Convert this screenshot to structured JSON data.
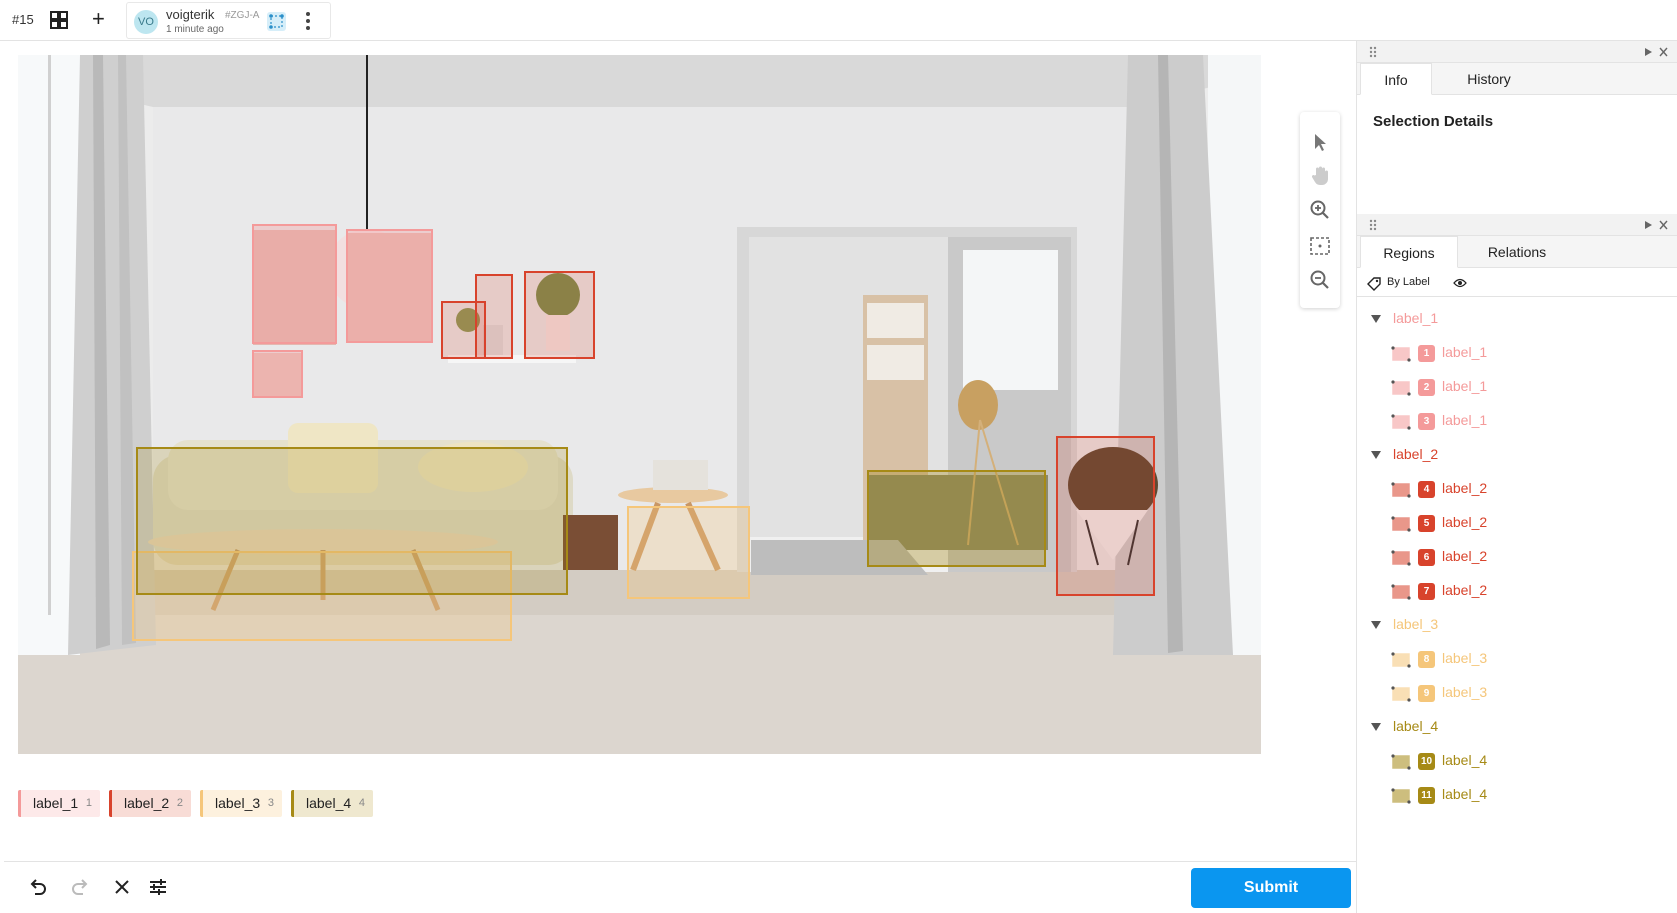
{
  "topbar": {
    "task_id": "#15",
    "grid_icon": "grid-icon",
    "add_icon": "plus-icon",
    "add_glyph": "+",
    "user": {
      "initials": "VO",
      "name": "voigterik",
      "hash": "#ZGJ-A",
      "time": "1 minute ago"
    },
    "more_icon": "kebab-menu-icon"
  },
  "image": {
    "description_icon": "interior-photo"
  },
  "tools": [
    "pointer-icon",
    "hand-pan-icon",
    "zoom-in-icon",
    "fit-to-screen-icon",
    "zoom-out-icon"
  ],
  "labels": [
    {
      "name": "label_1",
      "hotkey": "1",
      "color": "#f49a9a"
    },
    {
      "name": "label_2",
      "hotkey": "2",
      "color": "#d8432c"
    },
    {
      "name": "label_3",
      "hotkey": "3",
      "color": "#f5c67a"
    },
    {
      "name": "label_4",
      "hotkey": "4",
      "color": "#a68a16"
    }
  ],
  "bottombar": {
    "icons": [
      "undo-icon",
      "redo-icon",
      "reset-icon",
      "settings-icon"
    ],
    "submit_label": "Submit"
  },
  "sidebar": {
    "top_tabs": [
      "Info",
      "History"
    ],
    "selection_title": "Selection Details",
    "bottom_tabs": [
      "Regions",
      "Relations"
    ],
    "by_label": "By Label",
    "groups": [
      {
        "name": "label_1",
        "color": "#f49a9a",
        "regions": [
          {
            "num": "1",
            "label": "label_1"
          },
          {
            "num": "2",
            "label": "label_1"
          },
          {
            "num": "3",
            "label": "label_1"
          }
        ]
      },
      {
        "name": "label_2",
        "color": "#d8432c",
        "regions": [
          {
            "num": "4",
            "label": "label_2"
          },
          {
            "num": "5",
            "label": "label_2"
          },
          {
            "num": "6",
            "label": "label_2"
          },
          {
            "num": "7",
            "label": "label_2"
          }
        ]
      },
      {
        "name": "label_3",
        "color": "#f5c67a",
        "regions": [
          {
            "num": "8",
            "label": "label_3"
          },
          {
            "num": "9",
            "label": "label_3"
          }
        ]
      },
      {
        "name": "label_4",
        "color": "#a68a16",
        "regions": [
          {
            "num": "10",
            "label": "label_4"
          },
          {
            "num": "11",
            "label": "label_4"
          }
        ]
      }
    ]
  }
}
